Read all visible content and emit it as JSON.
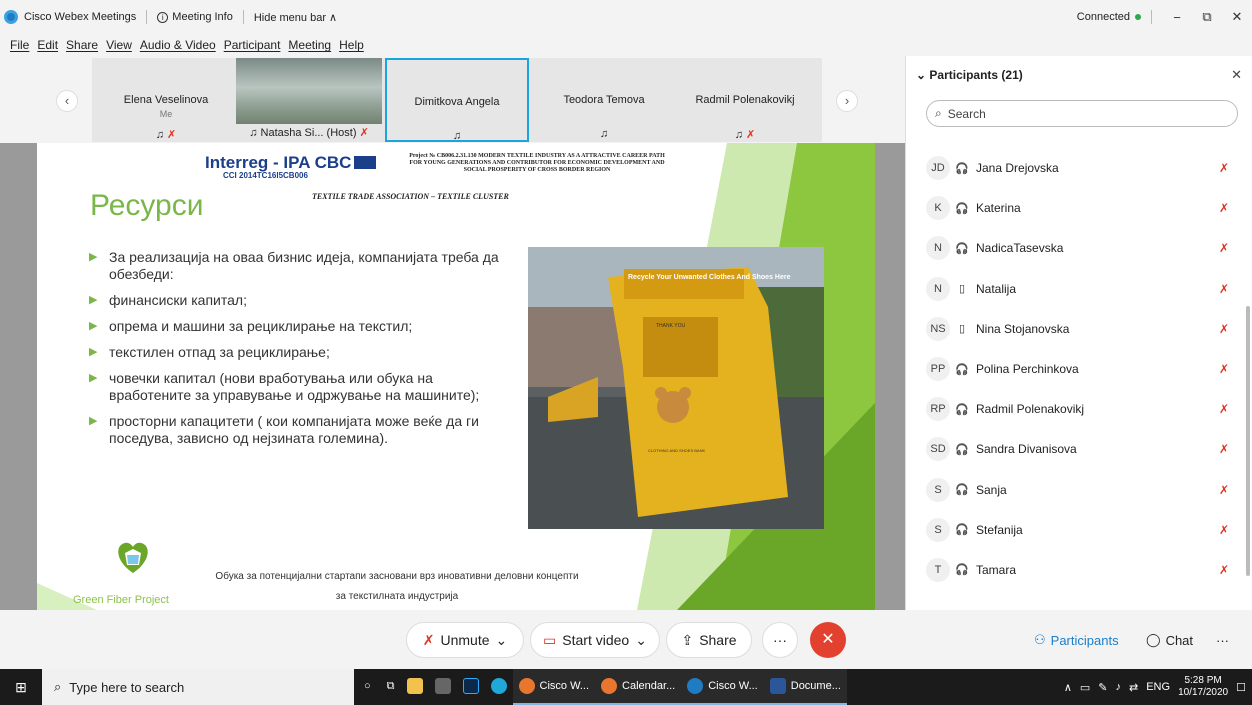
{
  "titlebar": {
    "app_title": "Cisco Webex Meetings",
    "meeting_info": "Meeting Info",
    "hide_menu": "Hide menu bar ∧",
    "status": "Connected",
    "minimize": "−",
    "restore": "⧉",
    "close": "✕"
  },
  "menu": [
    "File",
    "Edit",
    "Share",
    "View",
    "Audio & Video",
    "Participant",
    "Meeting",
    "Help"
  ],
  "video_strip": {
    "tiles": [
      {
        "name": "Elena Veselinova",
        "sub": "Me",
        "icons": "🎧 🎙"
      },
      {
        "name": "Natasha Si... (Host)",
        "sub": "",
        "icons": "🎧"
      },
      {
        "name": "Dimitkova Angela",
        "sub": "",
        "icons": "🎧"
      },
      {
        "name": "Teodora Temova",
        "sub": "",
        "icons": "🎧"
      },
      {
        "name": "Radmil Polenakovikj",
        "sub": "",
        "icons": "🎧 🎙"
      }
    ],
    "prev": "‹",
    "next": "›"
  },
  "slide": {
    "interreg": "Interreg - IPA CBC",
    "cci": "CCI 2014TC16I5CB006",
    "project_text": "Project № CB006.2.31.130 MODERN TEXTILE INDUSTRY AS A ATTRACTIVE CAREER PATH FOR YOUNG GENERATIONS AND CONTRIBUTOR FOR ECONOMIC DEVELOPMENT AND SOCIAL PROSPERITY OF CROSS BORDER REGION",
    "project_sub": "TEXTILE TRADE ASSOCIATION – TEXTILE CLUSTER",
    "title": "Ресурси",
    "bullets": [
      "За реализација на оваа бизнис идеја, компанијата треба да обезбеди:",
      " финансиски капитал;",
      " опрема и машини за рециклирање на текстил;",
      "текстилен отпад за рециклирање;",
      "човечки капитал (нови вработувања или обука на вработените за управување и одржување на машините);",
      "просторни капацитети ( кои компанијата може веќе да ги поседува, зависно од нејзината големина)."
    ],
    "photo_sign": "Recycle Your Unwanted Clothes And Shoes Here",
    "photo_thank": "THANK YOU",
    "photo_bank": "CLOTHING AND SHOES BANK",
    "footer_line1": "Обука за потенцијални стартапи засновани врз иновативни деловни концепти",
    "footer_line2": "за текстилната индустрија",
    "logo_text": "Green Fiber Project"
  },
  "participants_panel": {
    "title": "Participants (21)",
    "search_placeholder": "Search",
    "rows": [
      {
        "initials": "JD",
        "name": "Jana Drejovska",
        "device": "🎧"
      },
      {
        "initials": "K",
        "name": "Katerina",
        "device": "🎧"
      },
      {
        "initials": "N",
        "name": "NadicaTasevska",
        "device": "🎧"
      },
      {
        "initials": "N",
        "name": "Natalija",
        "device": "▯"
      },
      {
        "initials": "NS",
        "name": "Nina Stojanovska",
        "device": "▯"
      },
      {
        "initials": "PP",
        "name": "Polina Perchinkova",
        "device": "🎧"
      },
      {
        "initials": "RP",
        "name": "Radmil Polenakovikj",
        "device": "🎧"
      },
      {
        "initials": "SD",
        "name": "Sandra Divanisova",
        "device": "🎧"
      },
      {
        "initials": "S",
        "name": "Sanja",
        "device": "🎧"
      },
      {
        "initials": "S",
        "name": "Stefanija",
        "device": "🎧"
      },
      {
        "initials": "T",
        "name": "Tamara",
        "device": "🎧"
      }
    ]
  },
  "controls": {
    "unmute": "Unmute",
    "start_video": "Start video",
    "share": "Share",
    "more": "···",
    "end": "✕",
    "participants": "Participants",
    "chat": "Chat",
    "more_right": "···"
  },
  "taskbar": {
    "search_placeholder": "Type here to search",
    "apps": [
      {
        "label": "Cisco W...",
        "color": "#e8762d",
        "open": true
      },
      {
        "label": "Calendar...",
        "color": "#e8762d",
        "open": true
      },
      {
        "label": "Cisco W...",
        "color": "#1f7cc1",
        "open": true
      },
      {
        "label": "Docume...",
        "color": "#2b579a",
        "open": true
      }
    ],
    "lang": "ENG",
    "time": "5:28 PM",
    "date": "10/17/2020"
  },
  "colors": {
    "accent_blue": "#1ba5e0",
    "slide_green": "#7ab648",
    "mute_red": "#e0301e",
    "end_red": "#e3412f"
  }
}
